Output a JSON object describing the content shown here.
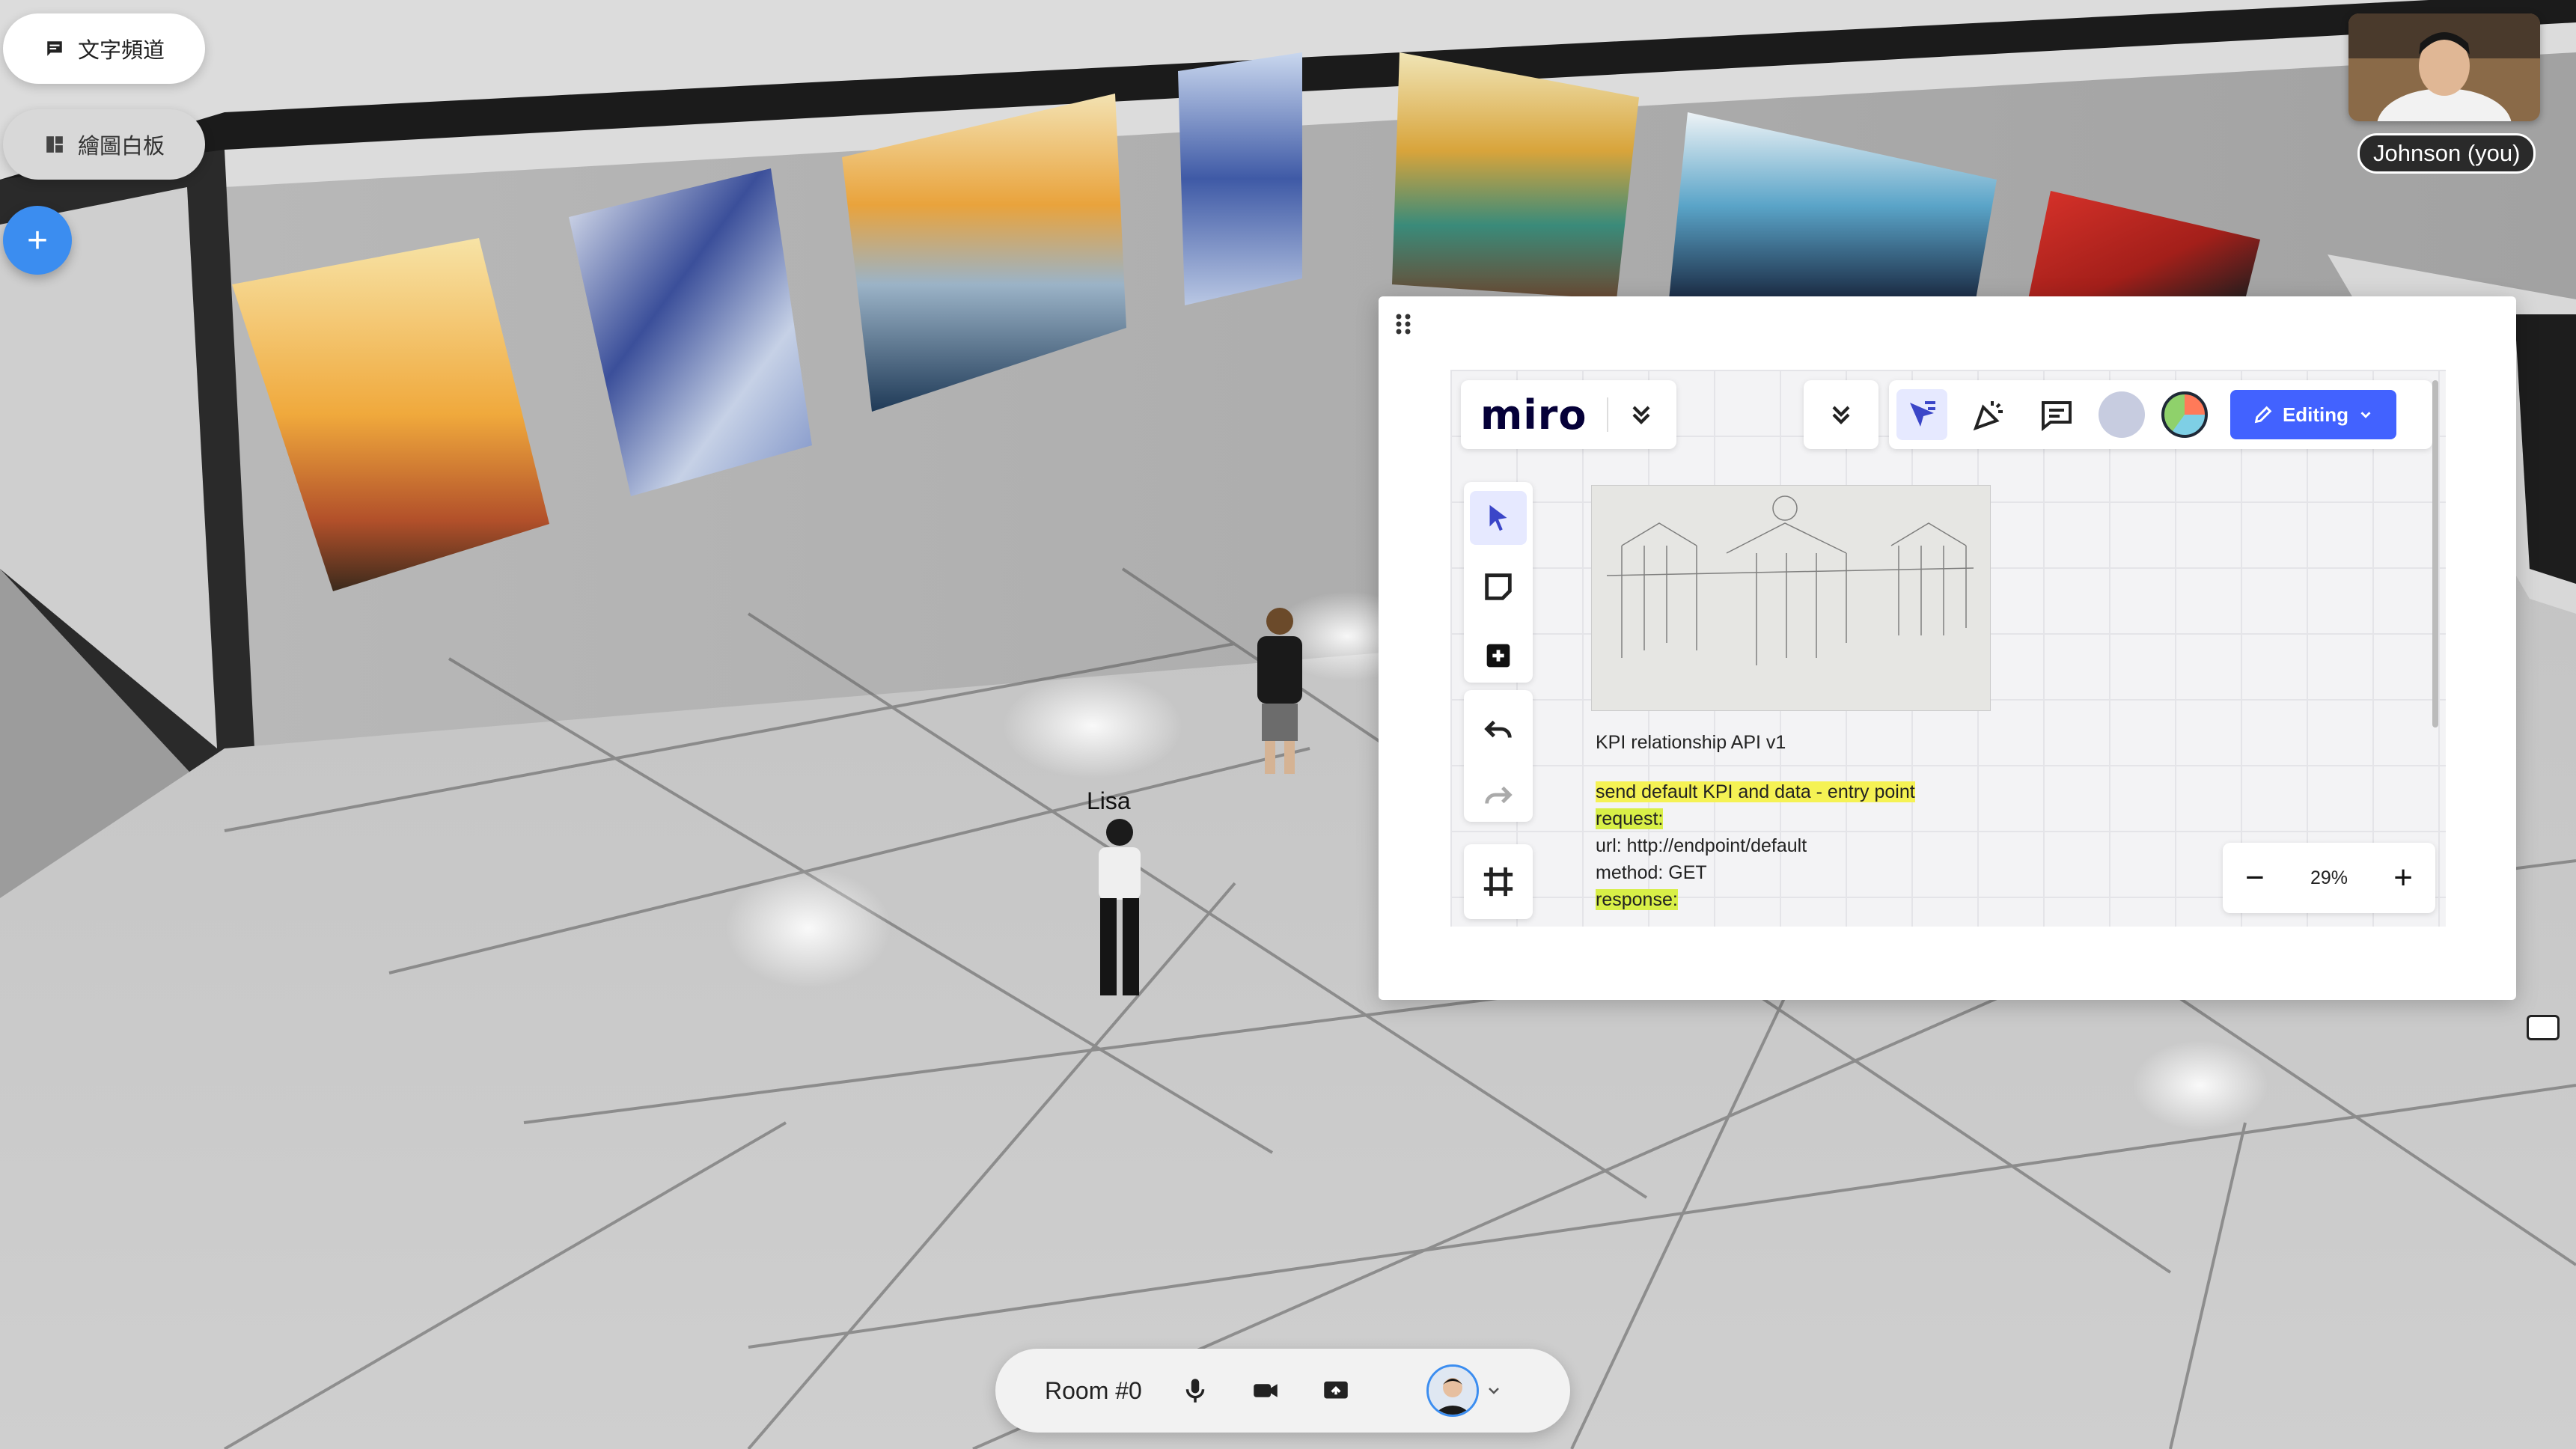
{
  "left_panel": {
    "chat_channel": "文字頻道",
    "whiteboard": "繪圖白板",
    "add": "+"
  },
  "self_video": {
    "name": "Johnson (you)"
  },
  "avatars": {
    "name": "Lisa"
  },
  "miro": {
    "logo": "miro",
    "editing": "Editing",
    "zoom": "29%",
    "zoom_minus": "−",
    "zoom_plus": "+",
    "note": {
      "title": "KPI relationship API v1",
      "line1": "send default KPI and data - entry point",
      "line2": "request:",
      "line3": "url: http://endpoint/default",
      "line4": "method: GET",
      "line5": "response:"
    }
  },
  "bottom_bar": {
    "room": "Room #0"
  }
}
